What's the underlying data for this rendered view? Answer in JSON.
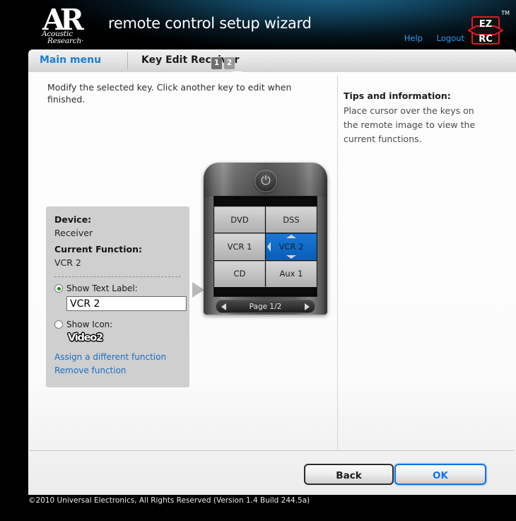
{
  "header": {
    "logo_letters": "AR",
    "logo_sub_line1": "Acoustic",
    "logo_sub_line2": "Research·",
    "title": "remote control setup wizard",
    "help_label": "Help",
    "logout_label": "Logout",
    "ezrc_top": "EZ",
    "ezrc_bottom": "RC",
    "trademark": "TM"
  },
  "tabs": {
    "main_menu_label": "Main menu",
    "current_label": "Key Edit Receiver",
    "steps": [
      {
        "label": "1",
        "state": "done"
      },
      {
        "label": "2",
        "state": "active"
      }
    ]
  },
  "main": {
    "instructions": "Modify the selected key. Click another key to edit when finished."
  },
  "tips": {
    "title": "Tips and information:",
    "body": "Place cursor over the keys on the remote image to view the current functions."
  },
  "option_panel": {
    "device_label": "Device:",
    "device_value": "Receiver",
    "function_label": "Current Function:",
    "function_value": "VCR 2",
    "show_text_label": "Show Text Label:",
    "text_input_value": "VCR 2",
    "text_input_placeholder": "",
    "show_icon_label": "Show Icon:",
    "icon_preview_label": "Video2",
    "selected_mode": "text",
    "assign_link": "Assign a different function",
    "remove_link": "Remove function"
  },
  "remote": {
    "power_glyph": "⏻",
    "keys": [
      {
        "label": "DVD",
        "selected": false
      },
      {
        "label": "DSS",
        "selected": false
      },
      {
        "label": "VCR 1",
        "selected": false
      },
      {
        "label": "VCR 2",
        "selected": true
      },
      {
        "label": "CD",
        "selected": false
      },
      {
        "label": "Aux 1",
        "selected": false
      }
    ],
    "page_label": "Page 1/2",
    "prev_icon": "prev-page-arrow",
    "next_icon": "next-page-arrow"
  },
  "footer": {
    "back_label": "Back",
    "ok_label": "OK",
    "copyright": "©2010 Universal Electronics, All Rights Reserved (Version 1.4 Build 244.5a)"
  },
  "colors": {
    "accent_blue": "#1a7fd4",
    "link_blue": "#1a6fc4",
    "selected_key_blue": "#0f6ac8",
    "ok_border": "#1273e6",
    "panel_grey": "#cfcfcf"
  }
}
